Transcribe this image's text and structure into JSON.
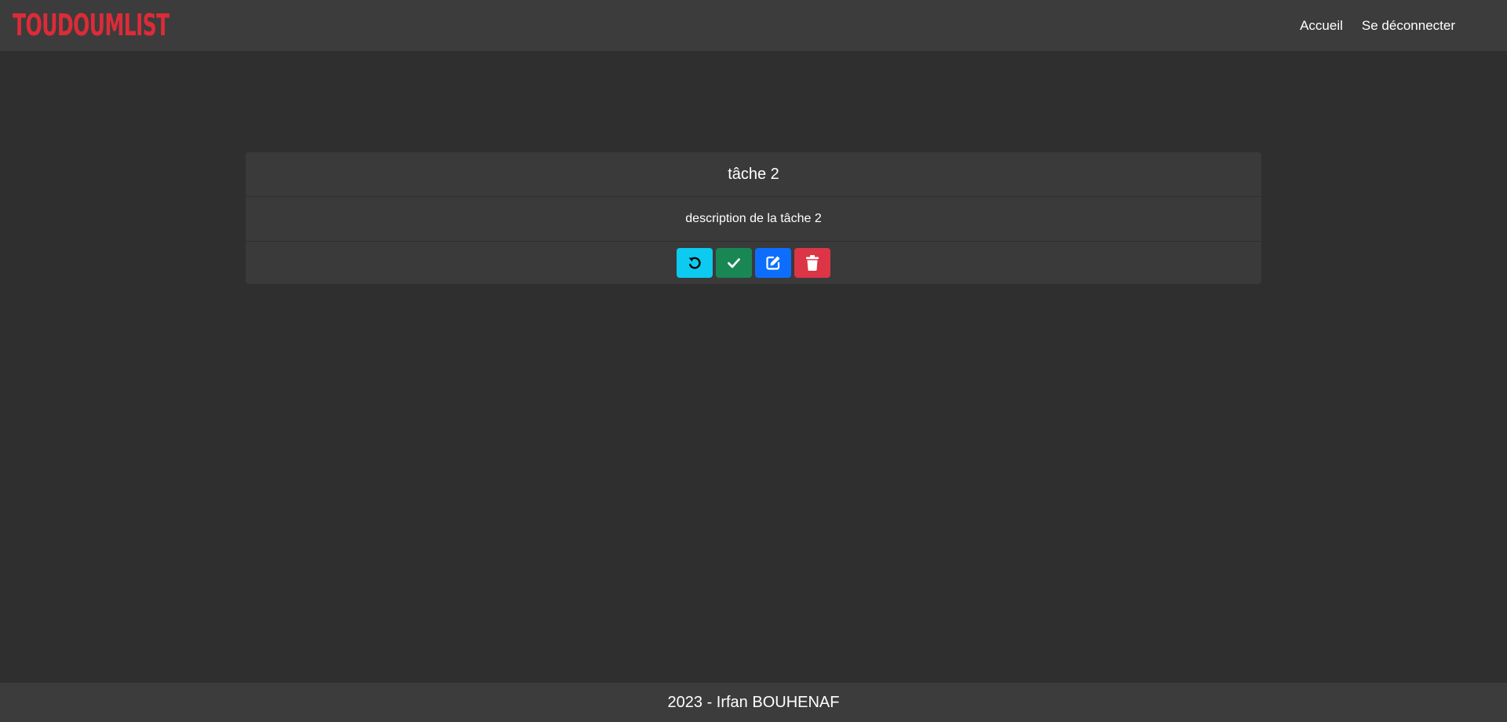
{
  "navbar": {
    "brand": "TOUDOUMLIST",
    "links": [
      {
        "label": "Accueil"
      },
      {
        "label": "Se déconnecter"
      }
    ]
  },
  "task": {
    "title": "tâche 2",
    "description": "description de la tâche 2",
    "actions": [
      {
        "icon": "undo-icon",
        "color": "#0dcaf0"
      },
      {
        "icon": "check-icon",
        "color": "#198754"
      },
      {
        "icon": "edit-icon",
        "color": "#0d6efd"
      },
      {
        "icon": "trash-icon",
        "color": "#dc3545"
      }
    ]
  },
  "footer": {
    "text": "2023 - Irfan BOUHENAF"
  },
  "colors": {
    "brand": "#dc2b38",
    "background": "#2f2f2f",
    "navbar": "#3c3c3c",
    "card": "#3a3a3a"
  }
}
